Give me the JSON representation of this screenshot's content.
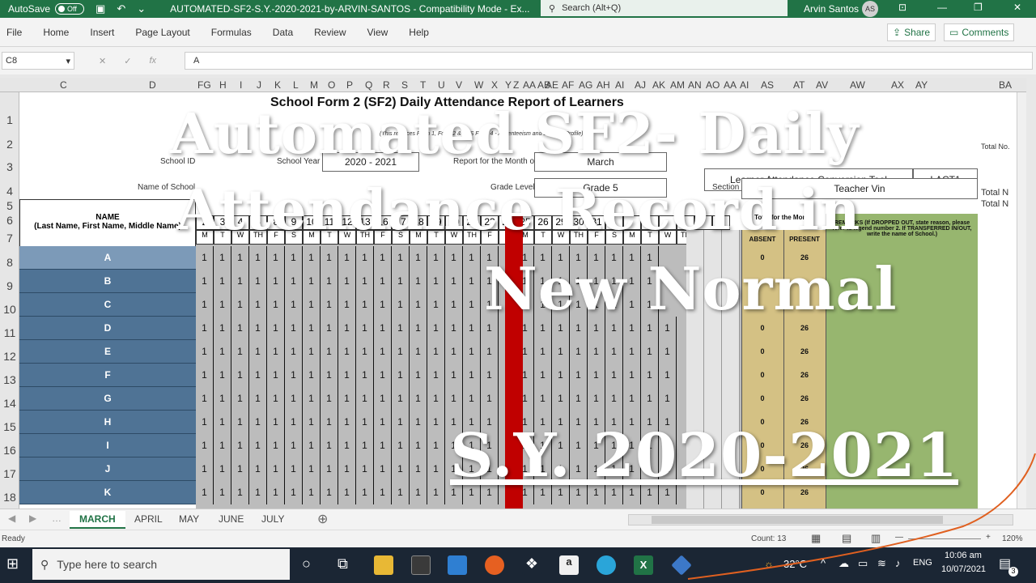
{
  "titlebar": {
    "autosave_label": "AutoSave",
    "autosave_state": "Off",
    "doc_title": "AUTOMATED-SF2-S.Y.-2020-2021-by-ARVIN-SANTOS  -  Compatibility Mode  -  Ex...",
    "search_placeholder": "Search (Alt+Q)",
    "user_name": "Arvin Santos",
    "user_initials": "AS",
    "accent": "#217346"
  },
  "menu": [
    "File",
    "Home",
    "Insert",
    "Page Layout",
    "Formulas",
    "Data",
    "Review",
    "View",
    "Help"
  ],
  "share_label": "Share",
  "comments_label": "Comments",
  "formula": {
    "name_box": "C8",
    "value": "A"
  },
  "columns": [
    "C",
    "D",
    "FG",
    "H",
    "I",
    "J",
    "K",
    "L",
    "M",
    "O",
    "P",
    "Q",
    "R",
    "S",
    "T",
    "U",
    "V",
    "W",
    "X",
    "Y",
    "Z",
    "AA",
    "AB",
    "AE",
    "AF",
    "AG",
    "AH",
    "AI",
    "AJ",
    "AK",
    "AM",
    "AN",
    "AO",
    "AA",
    "AI",
    "AS",
    "AT",
    "AV",
    "AW",
    "AX",
    "AY",
    "BA"
  ],
  "rows": [
    "1",
    "2",
    "3",
    "4",
    "5",
    "6",
    "7",
    "8",
    "9",
    "10",
    "11",
    "12",
    "13",
    "14",
    "15",
    "16",
    "17",
    "18"
  ],
  "form": {
    "title": "School Form 2 (SF2) Daily Attendance Report of Learners",
    "subtitle": "(This replaces Form 1, Form 2 & STS Form 4 - Absenteeism and Dropout Profile)",
    "school_id_label": "School ID",
    "school_year_label": "School Year",
    "school_year": "2020 - 2021",
    "report_month_label": "Report for the Month of",
    "month": "March",
    "tool_name": "Learner Attendance Conversion Tool",
    "tool_code": "LACT1",
    "school_name_label": "Name of School",
    "grade_level_label": "Grade Level",
    "grade": "Grade 5",
    "section_label": "Section",
    "teacher": "Teacher Vin",
    "total_label_1": "Total No.",
    "total_label_2": "Total N",
    "total_label_3": "Total N",
    "name_header": "NAME",
    "name_sub": "(Last Name, First Name, Middle Name)",
    "day_numbers": [
      "2",
      "3",
      "4",
      "5",
      "8",
      "9",
      "10",
      "11",
      "12",
      "13",
      "16",
      "17",
      "18",
      "19",
      "20",
      "22",
      "23",
      "24",
      "25",
      "26",
      "29",
      "30",
      "31"
    ],
    "day_letters": [
      "M",
      "T",
      "W",
      "TH",
      "F",
      "S",
      "M",
      "T",
      "W",
      "TH",
      "F",
      "S",
      "M",
      "T",
      "W",
      "TH",
      "F",
      "S",
      "M",
      "T",
      "W",
      "TH",
      "F",
      "S",
      "M",
      "T",
      "W",
      "TH",
      "F",
      "S"
    ],
    "absent_label": "ABSENT",
    "present_label": "PRESENT",
    "month_total_label": "Total for the Month",
    "remarks_label": "REMARKS (If DROPPED OUT, state reason, please refer to legend number 2. If TRANSFERRED IN/OUT, write the name of School.)"
  },
  "learners": [
    {
      "name": "A",
      "absent": "",
      "present": ""
    },
    {
      "name": "B",
      "absent": "",
      "present": ""
    },
    {
      "name": "C",
      "absent": "",
      "present": ""
    },
    {
      "name": "D",
      "absent": "0",
      "present": "26"
    },
    {
      "name": "E",
      "absent": "0",
      "present": "26"
    },
    {
      "name": "F",
      "absent": "0",
      "present": "26"
    },
    {
      "name": "G",
      "absent": "0",
      "present": "26"
    },
    {
      "name": "H",
      "absent": "0",
      "present": "26"
    },
    {
      "name": "I",
      "absent": "0",
      "present": "26"
    },
    {
      "name": "J",
      "absent": "0",
      "present": "26"
    },
    {
      "name": "K",
      "absent": "0",
      "present": "26"
    }
  ],
  "first_present": {
    "absent": "0",
    "present": "26"
  },
  "mark_value": "1",
  "overlay": {
    "line1": "Automated SF2- Daily",
    "line2": "Attendance Record in",
    "line3": "New Normal",
    "line4": "S.Y. 2020-2021"
  },
  "sheet_tabs": [
    "MARCH",
    "APRIL",
    "MAY",
    "JUNE",
    "JULY"
  ],
  "status": {
    "ready": "Ready",
    "count": "Count: 13",
    "zoom": "120%"
  },
  "taskbar": {
    "search_placeholder": "Type here to search",
    "temp": "32°C",
    "lang": "ENG",
    "time": "10:06 am",
    "date": "10/07/2021",
    "notif": "3"
  }
}
